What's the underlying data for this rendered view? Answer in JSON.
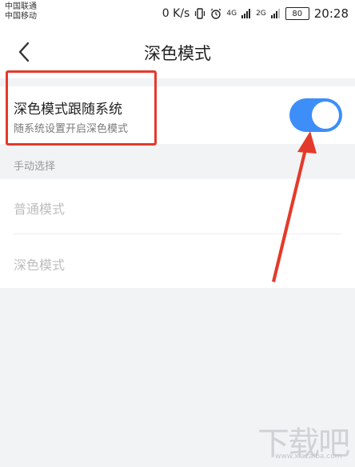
{
  "status_bar": {
    "carrier1": "中国联通",
    "carrier2": "中国移动",
    "speed": "0 K/s",
    "signal1": "4G",
    "signal2": "2G",
    "battery": "80",
    "time": "20:28"
  },
  "header": {
    "title": "深色模式",
    "back_icon": "chevron-left-icon"
  },
  "follow_system": {
    "title": "深色模式跟随系统",
    "description": "随系统设置开启深色模式",
    "enabled": true
  },
  "manual": {
    "section_label": "手动选择",
    "options": [
      "普通模式",
      "深色模式"
    ]
  },
  "watermark": {
    "text": "下载吧",
    "url": "www.xiazaiba.com"
  },
  "colors": {
    "accent": "#3d8ef8",
    "annotation": "#e43a2b"
  }
}
